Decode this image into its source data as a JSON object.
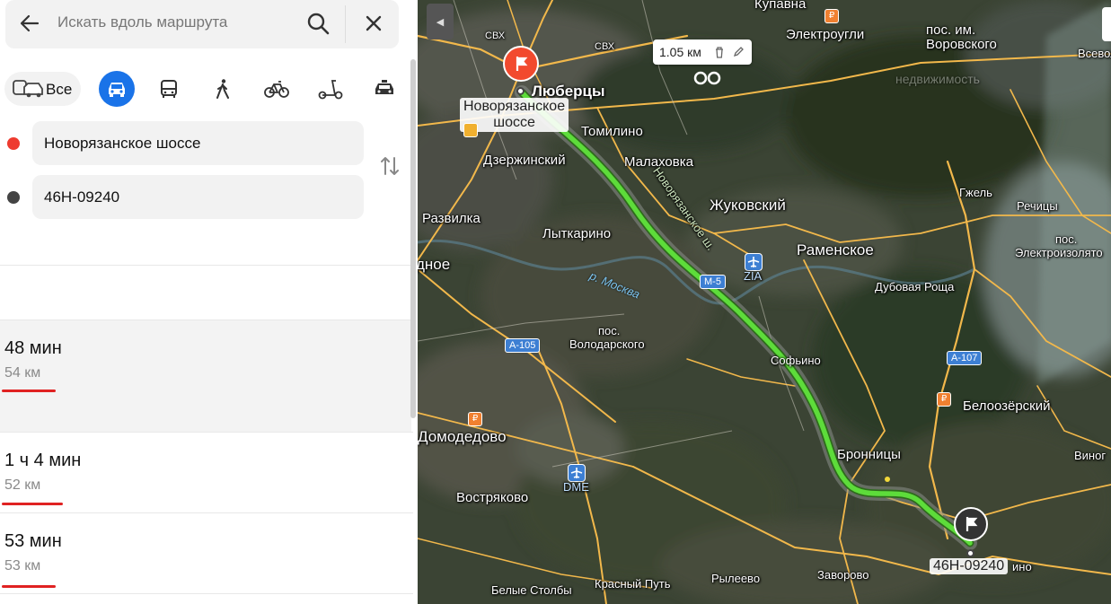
{
  "search": {
    "placeholder": "Искать вдоль маршрута"
  },
  "modes": {
    "all_label": "Все"
  },
  "route_points": {
    "from": "Новорязанское шоссе",
    "to": "46Н-09240"
  },
  "routes": [
    {
      "time": "48 мин",
      "distance": "54 км"
    },
    {
      "time": "1 ч 4 мин",
      "distance": "52 км"
    },
    {
      "time": "53 мин",
      "distance": "53 км"
    }
  ],
  "map": {
    "ruler_label": "1.05 км",
    "start_label_line1": "Новорязанское",
    "start_label_line2": "шоссе",
    "end_label": "46Н-09240",
    "places": {
      "kupavna": "Купавна",
      "elektrougli": "Электроугли",
      "vorovskogo1": "пос. им.",
      "vorovskogo2": "Воровского",
      "vsevolod": "Всеволод",
      "lyubertsy": "Люберцы",
      "tomilino": "Томилино",
      "dzerzhinsky": "Дзержинский",
      "malakhovka": "Малаховка",
      "zhukovsky": "Жуковский",
      "gzhel": "Гжель",
      "rechitsy": "Речицы",
      "razvilka": "Развилка",
      "lytkarino": "Лыткарино",
      "ramenskoe": "Раменское",
      "pos": "пос.",
      "elektroizolyator": "Электроизолято",
      "dnoe": "дное",
      "dubovaya_roscha": "Дубовая Роща",
      "volodarskogo1": "пос.",
      "volodarskogo2": "Володарского",
      "sofyino": "Софьино",
      "beloozersky": "Белоозёрский",
      "domodedovo": "Домодедово",
      "bronnitsy": "Бронницы",
      "vinogr": "Виног",
      "vostryakovo": "Востряково",
      "ryleevo": "Рылеево",
      "zavorovo": "Заворово",
      "belye_stolby": "Белые Столбы",
      "krasny_put": "Красный Путь",
      "ino": "ино",
      "svh1": "СВХ",
      "svh2": "СВХ",
      "nedvizh": "недвижимость"
    },
    "river": "р. Москва",
    "road_name": "Новорязанское ш.",
    "shields": {
      "a105": "А-105",
      "m5": "М-5",
      "a107": "А-107"
    },
    "airports": {
      "zia": "ZIA",
      "dme": "DME"
    }
  },
  "colors": {
    "accent": "#1a73e8",
    "route": "#5ddc3a",
    "start_pin": "#f24a2e",
    "underline": "#e02222"
  }
}
